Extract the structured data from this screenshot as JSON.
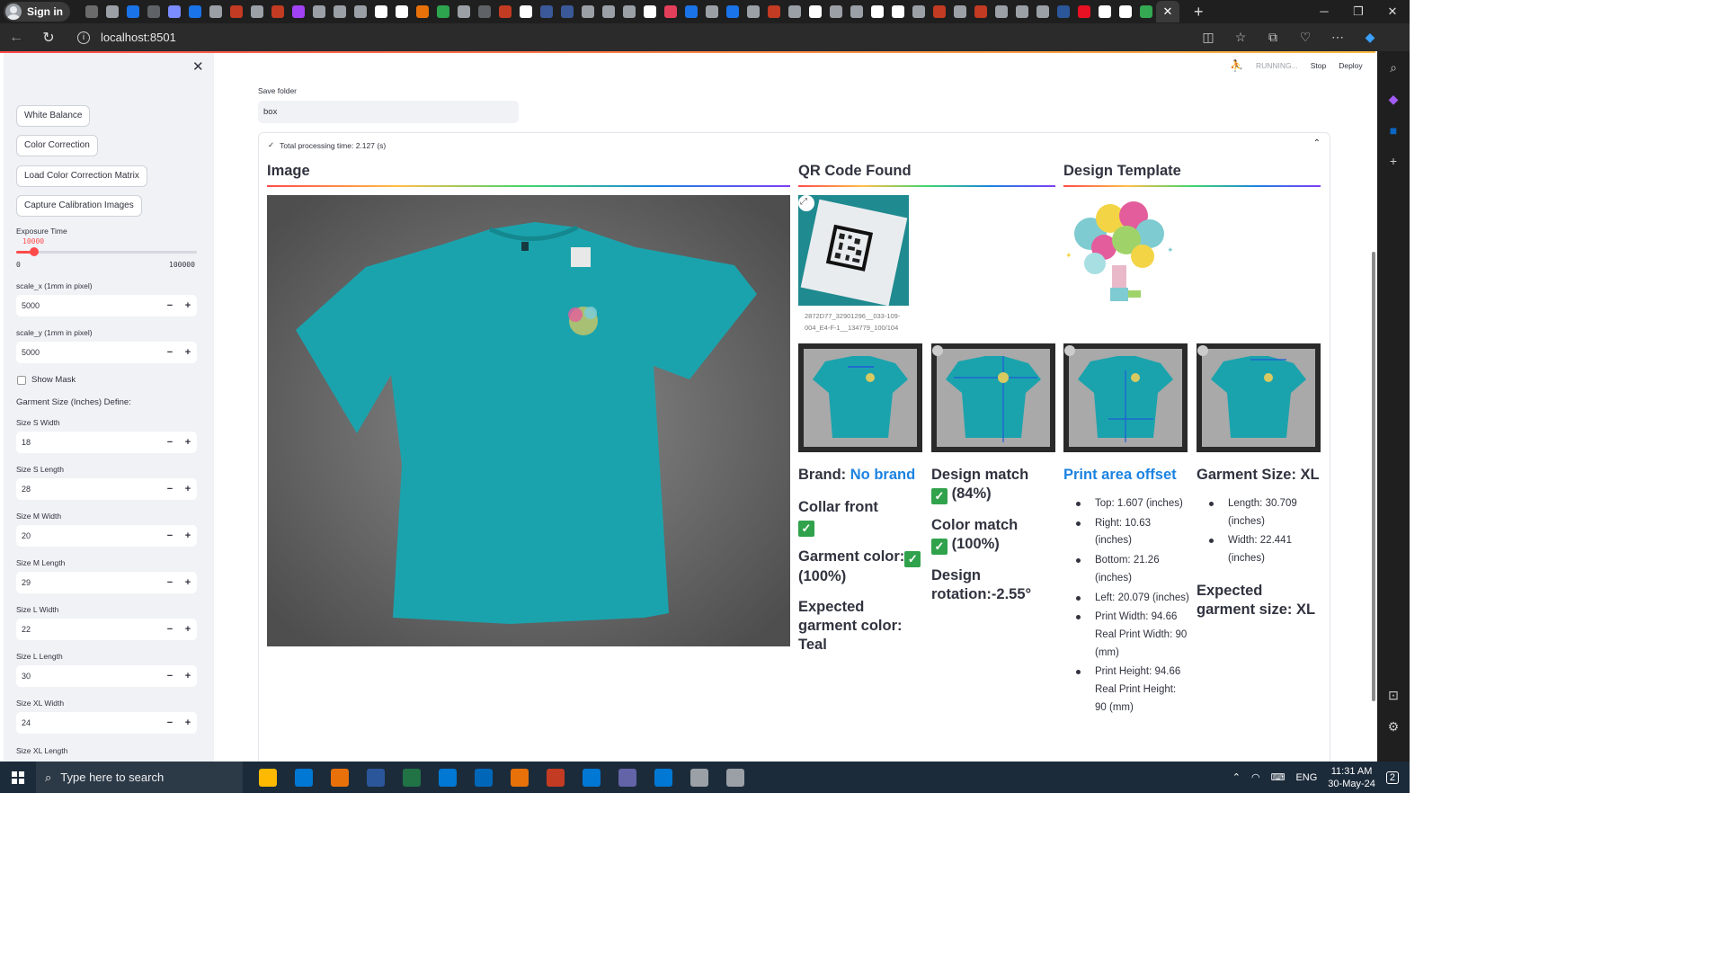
{
  "browser": {
    "signin_label": "Sign in",
    "url": "localhost:8501",
    "tab_favicon_colors": [
      "#6b6b6b",
      "#9aa0a6",
      "#1a73e8",
      "#5f6368",
      "#7a8cff",
      "#1a73e8",
      "#9aa0a6",
      "#c23b22",
      "#9aa0a6",
      "#c23b22",
      "#a142f4",
      "#9aa0a6",
      "#9aa0a6",
      "#9aa0a6",
      "#ffffff",
      "#ffffff",
      "#e8710a",
      "#2da44e",
      "#9aa0a6",
      "#5f6368",
      "#c23b22",
      "#ffffff",
      "#3b5998",
      "#3b5998",
      "#9aa0a6",
      "#9aa0a6",
      "#9aa0a6",
      "#ffffff",
      "#e43f5a",
      "#1a73e8",
      "#9aa0a6",
      "#1a73e8",
      "#9aa0a6",
      "#c23b22",
      "#9aa0a6",
      "#ffffff",
      "#9aa0a6",
      "#9aa0a6",
      "#ffffff",
      "#ffffff",
      "#9aa0a6",
      "#c23b22",
      "#9aa0a6",
      "#c23b22",
      "#9aa0a6",
      "#9aa0a6",
      "#9aa0a6",
      "#2b579a",
      "#e81123",
      "#ffffff",
      "#ffffff",
      "#34a853"
    ]
  },
  "app": {
    "status": {
      "running_label": "RUNNING...",
      "stop_label": "Stop",
      "deploy_label": "Deploy"
    },
    "sidebar": {
      "buttons": [
        "White Balance",
        "Color Correction",
        "Load Color Correction Matrix",
        "Capture Calibration Images"
      ],
      "exposure": {
        "label": "Exposure Time",
        "value": "10000",
        "min": "0",
        "max": "100000",
        "fraction": 0.1
      },
      "scale_x": {
        "label": "scale_x (1mm in pixel)",
        "value": "5000"
      },
      "scale_y": {
        "label": "scale_y (1mm in pixel)",
        "value": "5000"
      },
      "show_mask_label": "Show Mask",
      "garment_size_heading": "Garment Size (Inches) Define:",
      "size_fields": [
        {
          "label": "Size S Width",
          "value": "18"
        },
        {
          "label": "Size S Length",
          "value": "28"
        },
        {
          "label": "Size M Width",
          "value": "20"
        },
        {
          "label": "Size M Length",
          "value": "29"
        },
        {
          "label": "Size L Width",
          "value": "22"
        },
        {
          "label": "Size L Length",
          "value": "30"
        },
        {
          "label": "Size XL Width",
          "value": "24"
        }
      ],
      "size_xl_length_label": "Size XL Length"
    },
    "save_folder": {
      "label": "Save folder",
      "value": "box"
    },
    "processing_time_label": "Total processing time: 2.127 (s)",
    "columns": {
      "image_title": "Image",
      "qr_title": "QR Code Found",
      "template_title": "Design Template"
    },
    "qr_caption": "2872D77_32901296__033-109-004_E4-F-1__134779_100/104",
    "results": {
      "brand_label": "Brand:",
      "brand_value": "No brand",
      "collar_label": "Collar front",
      "garment_color_label": "Garment color:",
      "garment_color_pct": "(100%)",
      "expected_color": "Expected garment color: Teal",
      "design_match_label": "Design match",
      "design_match_pct": "(84%)",
      "color_match_label": "Color match",
      "color_match_pct": "(100%)",
      "design_rotation": "Design rotation:-2.55°",
      "print_area_title": "Print area offset",
      "print_area_items": [
        "Top: 1.607 (inches)",
        "Right: 10.63 (inches)",
        "Bottom: 21.26 (inches)",
        "Left: 20.079 (inches)",
        "Print Width: 94.66 Real Print Width: 90 (mm)",
        "Print Height: 94.66 Real Print Height: 90 (mm)"
      ],
      "garment_size_title": "Garment Size: XL",
      "garment_size_items": [
        "Length: 30.709 (inches)",
        "Width: 22.441 (inches)"
      ],
      "expected_size": "Expected garment size: XL"
    }
  },
  "taskbar": {
    "search_placeholder": "Type here to search",
    "language": "ENG",
    "time": "11:31 AM",
    "date": "30-May-24",
    "notification_count": "2",
    "app_colors": [
      "#ffb900",
      "#0078d4",
      "#e8710a",
      "#2b579a",
      "#217346",
      "#0078d4",
      "#0067b8",
      "#e8710a",
      "#c23b22",
      "#0078d4",
      "#6264a7",
      "#0078d4",
      "#9aa0a6",
      "#9aa0a6"
    ]
  },
  "colors": {
    "accent": "#ff4b4b",
    "link_blue": "#1c83e1",
    "teal_shirt": "#1ba3ad",
    "check_green": "#31a24c"
  }
}
